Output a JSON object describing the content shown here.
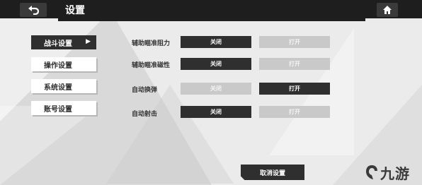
{
  "header": {
    "title": "设置",
    "back_icon": "back-arrow-icon",
    "home_icon": "home-icon"
  },
  "sidebar": {
    "items": [
      {
        "label": "战斗设置",
        "active": true
      },
      {
        "label": "操作设置",
        "active": false
      },
      {
        "label": "系统设置",
        "active": false
      },
      {
        "label": "账号设置",
        "active": false
      }
    ]
  },
  "settings": [
    {
      "label": "辅助瞄准阻力",
      "off_label": "关闭",
      "on_label": "打开",
      "selected": "关闭"
    },
    {
      "label": "辅助瞄准磁性",
      "off_label": "关闭",
      "on_label": "打开",
      "selected": "关闭"
    },
    {
      "label": "自动换弹",
      "off_label": "关闭",
      "on_label": "打开",
      "selected": "打开"
    },
    {
      "label": "自动射击",
      "off_label": "关闭",
      "on_label": "打开",
      "selected": "关闭"
    }
  ],
  "footer": {
    "cancel_label": "取消设置"
  },
  "watermark": {
    "text": "九游"
  },
  "colors": {
    "active": "#2f2f2f",
    "inactive": "#c9c9c9",
    "background": "#e4e4e4"
  }
}
